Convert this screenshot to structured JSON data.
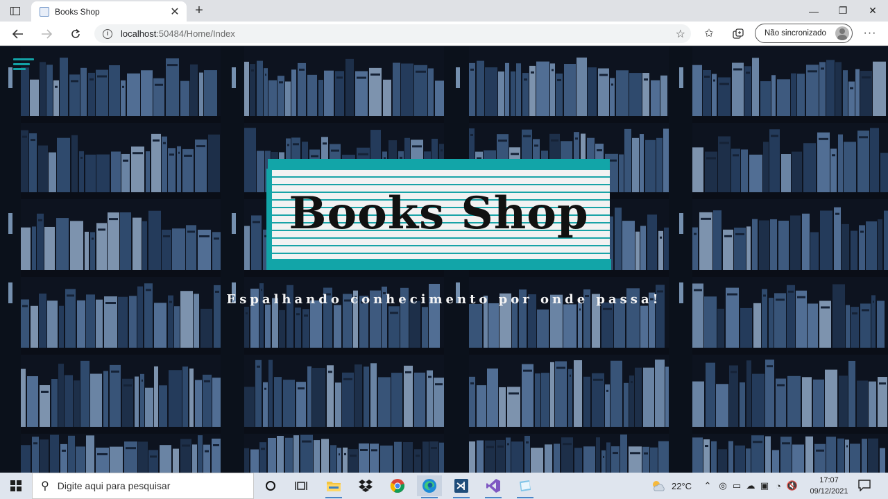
{
  "browser": {
    "tab_title": "Books Shop",
    "url_host": "localhost",
    "url_path": ":50484/Home/Index",
    "profile_label": "Não sincronizado",
    "new_tab_symbol": "+",
    "close_symbol": "✕",
    "window_controls": {
      "minimize": "—",
      "maximize": "❐",
      "close": "✕"
    }
  },
  "hero": {
    "brand_title": "Books Shop",
    "tagline": "Espalhando conhecimento por onde passa!",
    "accent_color": "#12a5a8"
  },
  "taskbar": {
    "search_placeholder": "Digite aqui para pesquisar",
    "weather": "22°C",
    "time": "17:07",
    "date": "09/12/2021",
    "pinned_apps": [
      "task-view",
      "file-explorer",
      "dropbox",
      "chrome",
      "edge",
      "visual-studio-code",
      "visual-studio",
      "notes"
    ]
  }
}
